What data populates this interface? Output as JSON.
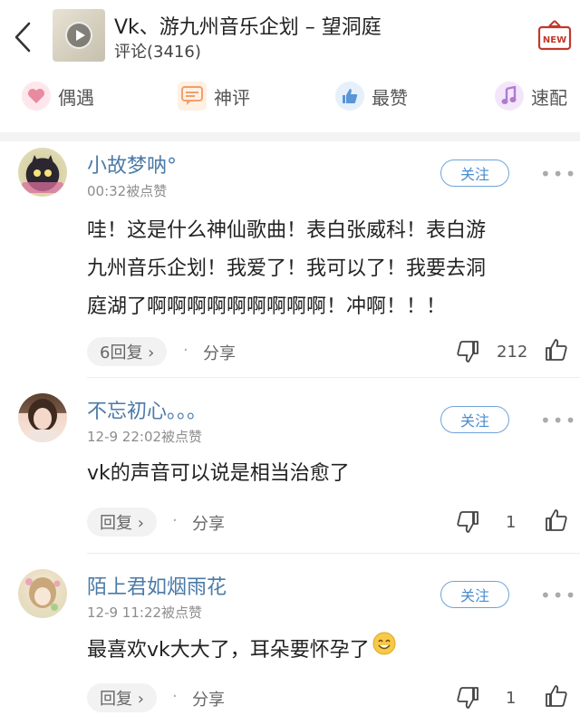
{
  "header": {
    "title": "Vk、游九州音乐企划 – 望洞庭",
    "subtitle": "评论(3416)",
    "new_badge": "NEW"
  },
  "tabs": [
    {
      "label": "偶遇",
      "icon": "heart-icon",
      "color": "#e98aa0"
    },
    {
      "label": "神评",
      "icon": "chat-icon",
      "color": "#f0a06a"
    },
    {
      "label": "最赞",
      "icon": "thumbs-up-icon",
      "color": "#5a95d6"
    },
    {
      "label": "速配",
      "icon": "music-note-icon",
      "color": "#b07ad0"
    }
  ],
  "comments": [
    {
      "username": "小故梦呐°",
      "time": "00:32被点赞",
      "follow": "关注",
      "text_lines": [
        "哇！这是什么神仙歌曲！表白张威科！表白游",
        "九州音乐企划！我爱了！我可以了！我要去洞",
        "庭湖了啊啊啊啊啊啊啊啊啊！冲啊！！！"
      ],
      "replies": "6回复 ›",
      "share": "分享",
      "likes": "212"
    },
    {
      "username": "不忘初心。。。",
      "time": "12-9 22:02被点赞",
      "follow": "关注",
      "text_lines": [
        "vk的声音可以说是相当治愈了"
      ],
      "replies": "回复 ›",
      "share": "分享",
      "likes": "1"
    },
    {
      "username": "陌上君如烟雨花",
      "time": "12-9 11:22被点赞",
      "follow": "关注",
      "text_lines": [
        "最喜欢vk大大了，耳朵要怀孕了"
      ],
      "replies": "回复 ›",
      "share": "分享",
      "likes": "1"
    }
  ],
  "ui": {
    "dot": "·",
    "more": "•••"
  }
}
